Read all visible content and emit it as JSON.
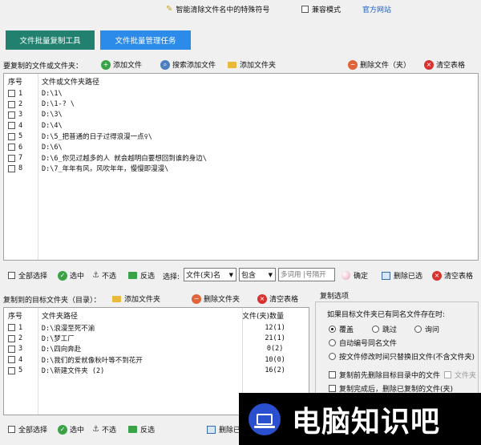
{
  "header": {
    "link1": "智能清除文件名中的特殊符号",
    "compat_mode": "兼容模式",
    "official_site": "官方网站"
  },
  "tabs": [
    {
      "label": "文件批量复制工具"
    },
    {
      "label": "文件批量管理任务"
    }
  ],
  "source": {
    "title": "要复制的文件或文件夹：",
    "add_file": "添加文件",
    "search_add": "搜索添加文件",
    "add_folder": "添加文件夹",
    "delete": "删除文件（夹）",
    "clear": "清空表格",
    "col_index": "序号",
    "col_path": "文件或文件夹路径",
    "rows": [
      {
        "n": "1",
        "path": "D:\\1\\"
      },
      {
        "n": "2",
        "path": "D:\\1-? \\"
      },
      {
        "n": "3",
        "path": "D:\\3\\"
      },
      {
        "n": "4",
        "path": "D:\\4\\"
      },
      {
        "n": "5",
        "path": "D:\\5_把普通的日子过得浪漫一点♀\\"
      },
      {
        "n": "6",
        "path": "D:\\6\\"
      },
      {
        "n": "7",
        "path": "D:\\6_你见过越多的人 就会越明白要想回到谁的身边\\"
      },
      {
        "n": "8",
        "path": "D:\\7_年年有风，风吹年年，慢慢即漫漫\\"
      }
    ]
  },
  "filter_bar": {
    "select_all": "全部选择",
    "select": "选中",
    "deselect": "不选",
    "invert": "反选",
    "choose_label": "选择:",
    "field_value": "文件(夹)名",
    "match_value": "包含",
    "keyword_placeholder": "多词用 |号隔开",
    "confirm": "确定",
    "delete_selected": "删除已选",
    "clear": "清空表格"
  },
  "target": {
    "title": "复制到的目标文件夹（目录）：",
    "add_folder": "添加文件夹",
    "delete_folder": "删除文件夹",
    "clear": "清空表格",
    "col_index": "序号",
    "col_path": "文件夹路径",
    "col_count": "文件(夹)数量",
    "rows": [
      {
        "n": "1",
        "path": "D:\\浪漫至死不渝",
        "count": "12(1)"
      },
      {
        "n": "2",
        "path": "D:\\梦工厂",
        "count": "21(1)"
      },
      {
        "n": "3",
        "path": "D:\\四向奔赴",
        "count": "0(2)"
      },
      {
        "n": "4",
        "path": "D:\\我们的爱就像秋叶等不到花开",
        "count": "10(0)"
      },
      {
        "n": "5",
        "path": "D:\\新建文件夹 (2)",
        "count": "16(2)"
      }
    ]
  },
  "bottom_bar": {
    "select_all": "全部选择",
    "select": "选中",
    "deselect": "不选",
    "invert": "反选",
    "delete_partial": "删除已"
  },
  "options": {
    "title": "复制选项",
    "question": "如果目标文件夹已有同名文件存在时:",
    "overwrite": "覆盖",
    "skip": "跳过",
    "ask": "询问",
    "auto_rename": "自动编号同名文件",
    "by_time": "按文件修改时间只替换旧文件(不含文件夹)",
    "pre_delete": "复制前先删除目标目录中的文件",
    "folder": "文件夹",
    "post_delete": "复制完成后，删除已复制的文件(夹)"
  },
  "watermark": {
    "text": "电脑知识吧"
  }
}
